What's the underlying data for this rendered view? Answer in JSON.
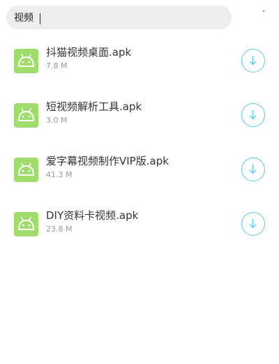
{
  "search": {
    "value": "视频",
    "icon_color": "#ededed"
  },
  "files": [
    {
      "name": "抖猫视频桌面.apk",
      "size": "7.8 M",
      "icon": "android-icon",
      "action_icon": "download-icon"
    },
    {
      "name": "短视频解析工具.apk",
      "size": "3.0 M",
      "icon": "android-icon",
      "action_icon": "download-icon"
    },
    {
      "name": "爱字幕视频制作VIP版.apk",
      "size": "41.3 M",
      "icon": "android-icon",
      "action_icon": "download-icon"
    },
    {
      "name": "DIY资料卡视频.apk",
      "size": "23.8 M",
      "icon": "android-icon",
      "action_icon": "download-icon"
    }
  ],
  "colors": {
    "android_icon_bg": "#9fdc6b",
    "download_accent": "#5ec8ea"
  }
}
